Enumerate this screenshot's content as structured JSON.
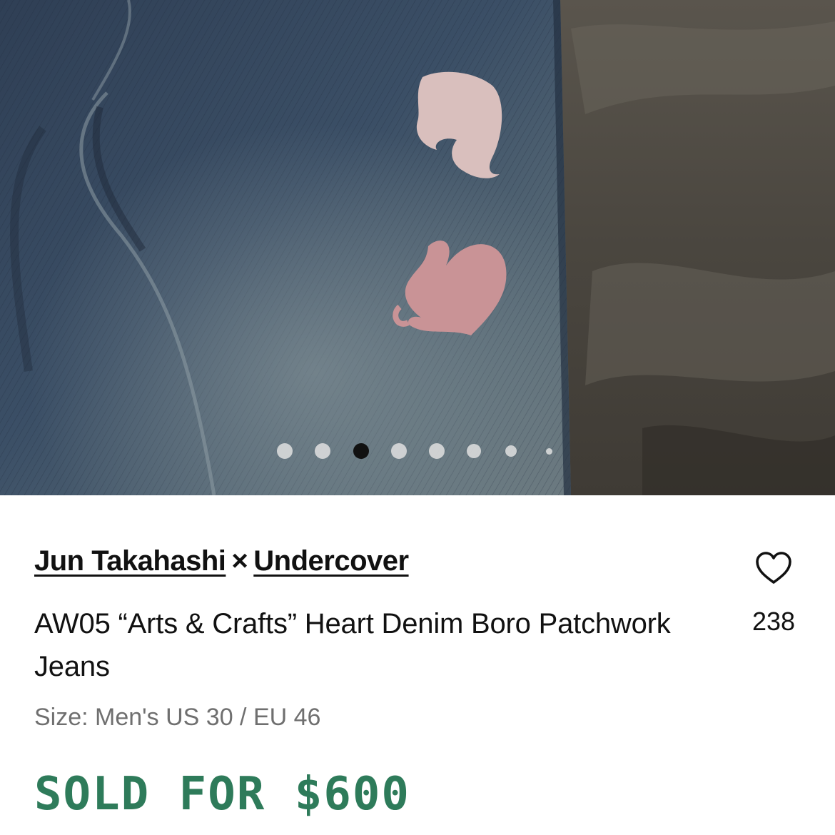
{
  "listing": {
    "designer_primary": "Jun Takahashi",
    "designer_separator": "×",
    "designer_secondary": "Undercover",
    "title": "AW05 “Arts & Crafts” Heart Denim Boro Patchwork Jeans",
    "size": "Size: Men's US 30 / EU 46",
    "sold_price": "SOLD FOR $600",
    "favorites_count": "238",
    "favorite_icon": "heart-outline-icon"
  },
  "gallery": {
    "image_count": 8,
    "active_index": 2
  },
  "colors": {
    "sold_green": "#2e7b5a",
    "text_primary": "#111111",
    "text_secondary": "#6f6f6f",
    "active_dot": "#111111"
  }
}
